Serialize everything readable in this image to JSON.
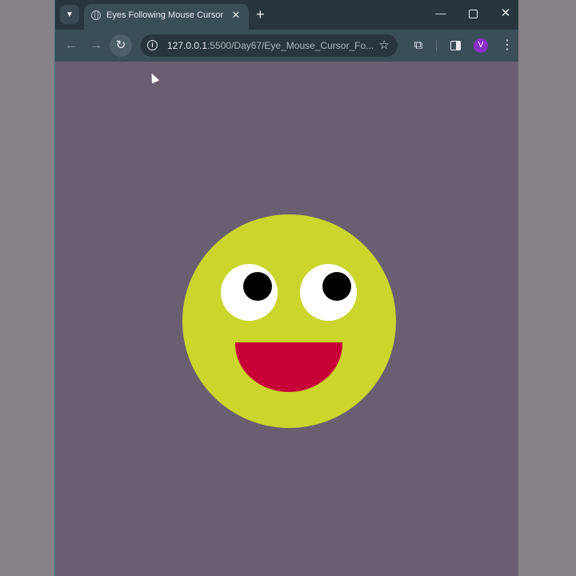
{
  "browser": {
    "tab": {
      "title": "Eyes Following Mouse Cursor",
      "close_glyph": "✕"
    },
    "new_tab_glyph": "+",
    "window_controls": {
      "minimize_glyph": "—",
      "close_glyph": "✕"
    },
    "toolbar": {
      "back_glyph": "←",
      "forward_glyph": "→",
      "reload_glyph": "↻",
      "url_host": "127.0.0.1",
      "url_rest": ":5500/Day67/Eye_Mouse_Cursor_Fo...",
      "star_glyph": "☆",
      "menu_glyph": "⋮",
      "profile_initial": "V"
    }
  },
  "colors": {
    "page_background": "#6b5e70",
    "face": "#cbd52c",
    "eye_white": "#ffffff",
    "pupil": "#000000",
    "mouth": "#c80038",
    "profile": "#8b2fc9"
  },
  "icons": {
    "tab_search": "chevron-down-icon",
    "favicon": "globe-icon",
    "extensions": "puzzle-icon",
    "side_panel": "side-panel-icon",
    "site_info": "info-icon"
  }
}
